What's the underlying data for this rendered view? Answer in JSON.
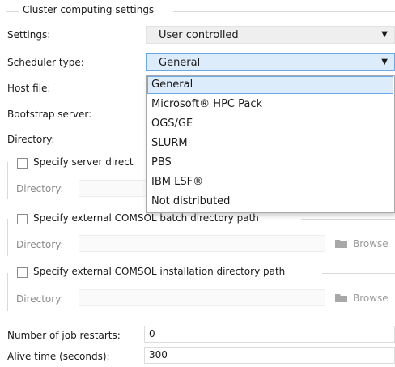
{
  "group_title": "Cluster computing settings",
  "settings": {
    "label": "Settings:",
    "value": "User controlled"
  },
  "scheduler": {
    "label": "Scheduler type:",
    "value": "General",
    "options": [
      "General",
      "Microsoft® HPC Pack",
      "OGS/GE",
      "SLURM",
      "PBS",
      "IBM LSF®",
      "Not distributed"
    ]
  },
  "host_file": {
    "label": "Host file:"
  },
  "bootstrap": {
    "label": "Bootstrap server:"
  },
  "directory": {
    "label": "Directory:"
  },
  "server_dir": {
    "checkbox_label": "Specify server direct",
    "dir_label": "Directory:"
  },
  "batch_dir": {
    "checkbox_label": "Specify external COMSOL batch directory path",
    "dir_label": "Directory:",
    "browse": "Browse"
  },
  "install_dir": {
    "checkbox_label": "Specify external COMSOL installation directory path",
    "dir_label": "Directory:",
    "browse": "Browse"
  },
  "restarts": {
    "label": "Number of job restarts:",
    "value": "0"
  },
  "alive": {
    "label": "Alive time (seconds):",
    "value": "300"
  },
  "colors": {
    "accent": "#6aa9e9",
    "selection_bg": "#dcecfb"
  },
  "icons": {
    "caret": "caret-down-icon",
    "folder": "folder-icon"
  }
}
